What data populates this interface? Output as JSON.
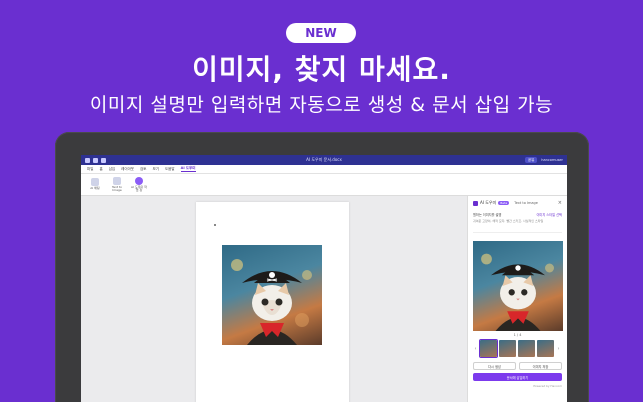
{
  "badge": "NEW",
  "headline": "이미지, 찾지 마세요.",
  "subline": "이미지 설명만 입력하면 자동으로 생성 & 문서 삽입 가능",
  "app": {
    "doc_title": "AI 도우미 문서.docx",
    "share_label": "공유",
    "user_name": "hancomuser",
    "menu": [
      "파일",
      "홈",
      "삽입",
      "레이아웃",
      "검토",
      "보기",
      "도움말",
      "AI 도우미"
    ],
    "menu_active_index": 7,
    "tools": [
      {
        "label": "AI 채팅",
        "icon": "chat-icon"
      },
      {
        "label": "Text to Image",
        "icon": "image-icon"
      },
      {
        "label": "AI 도우미 작업 창",
        "icon": "ai-icon"
      }
    ]
  },
  "panel": {
    "title": "AI 도우미",
    "beta": "Beta",
    "tab": "Text to Image",
    "prompt_label": "원하는 이미지를 설명",
    "style_option": "이미지 스타일 선택",
    "prompt_placeholder": "귀여운 고양이, 해적 모자, 빨간 스카프, 사실적인 스타일",
    "counter": "1 / 4",
    "btn_regenerate": "다시 생성",
    "btn_save": "이미지 저장",
    "btn_insert": "문서에 삽입하기",
    "footer": "Powered by Hancom"
  },
  "colors": {
    "background": "#6a2fd0",
    "titlebar": "#2e3192",
    "accent": "#7c3aed"
  }
}
